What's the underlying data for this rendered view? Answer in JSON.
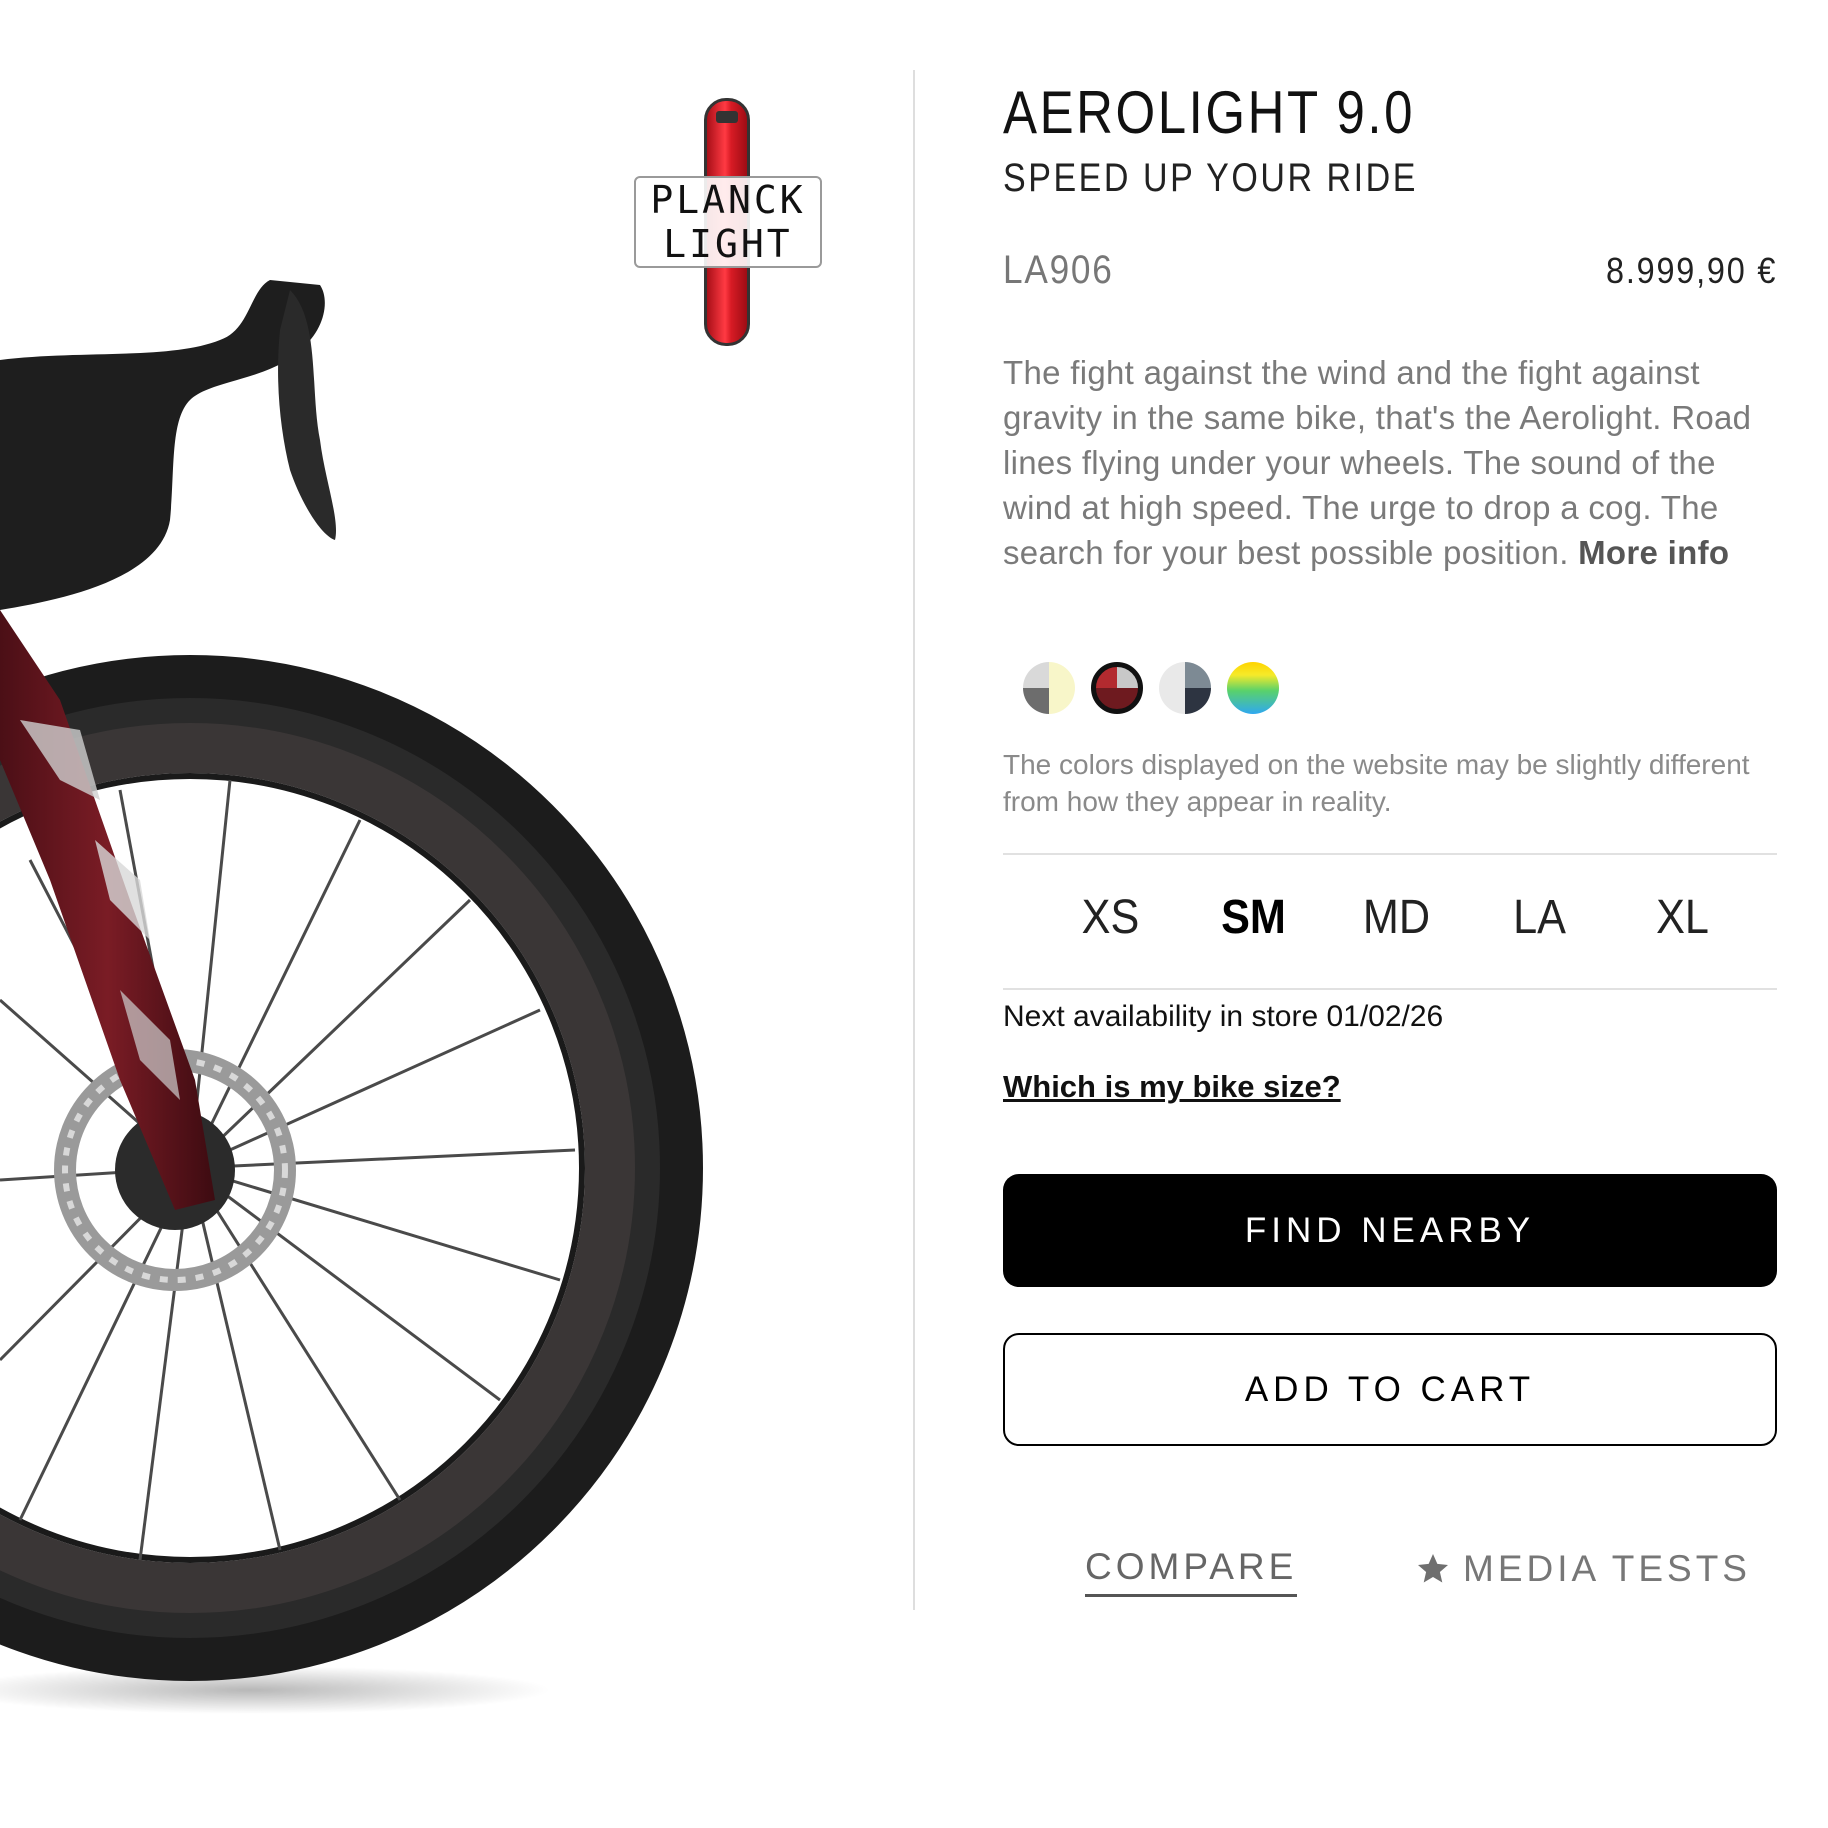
{
  "product": {
    "title": "AEROLIGHT 9.0",
    "subtitle": "SPEED UP YOUR RIDE",
    "sku": "LA906",
    "price": "8.999,90 €",
    "description": "The fight against the wind and the fight against gravity in the same bike, that's the Aerolight. Road lines flying under your wheels. The sound of the wind at high speed. The urge to drop a cog. The search for your best possible position. ",
    "more_info_label": "More info"
  },
  "badge": {
    "line1": "PLANCK",
    "line2": "LIGHT"
  },
  "colors": {
    "note": "The colors displayed on the website may be slightly different from how they appear in reality.",
    "swatch_names": [
      "grey-yellow",
      "dark-red",
      "grey-blue",
      "rainbow"
    ],
    "selected_index": 1
  },
  "sizes": {
    "options": [
      "XS",
      "SM",
      "MD",
      "LA",
      "XL"
    ],
    "selected": "SM"
  },
  "availability": "Next availability in store 01/02/26",
  "size_help_label": "Which is my bike size?",
  "actions": {
    "find_nearby": "FIND NEARBY",
    "add_to_cart": "ADD TO CART",
    "compare": "COMPARE",
    "media_tests": "MEDIA TESTS"
  },
  "icons": {
    "media_tests": "star-icon"
  },
  "theme": {
    "accent": "#000000",
    "muted_text": "#7a7a7a"
  }
}
